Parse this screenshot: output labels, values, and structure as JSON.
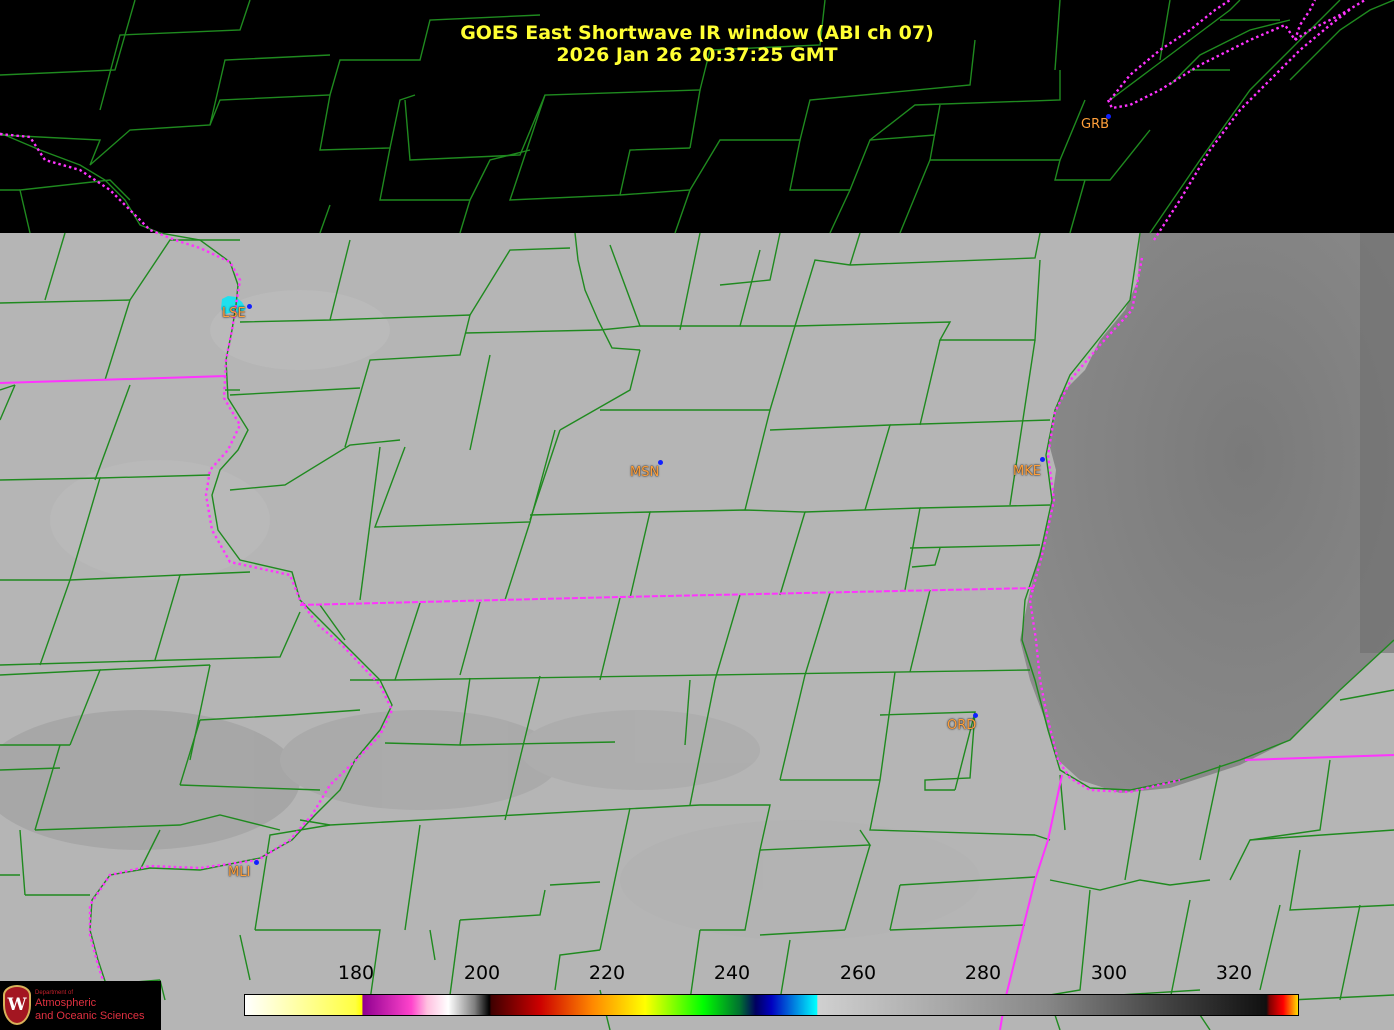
{
  "title": {
    "line1": "GOES East Shortwave IR window (ABI ch 07)",
    "line2": "2026 Jan 26  20:37:25 GMT"
  },
  "stations": [
    {
      "code": "GRB"
    },
    {
      "code": "LSE"
    },
    {
      "code": "MSN"
    },
    {
      "code": "MKE"
    },
    {
      "code": "ORD"
    },
    {
      "code": "MLI"
    }
  ],
  "colorbar": {
    "min": 163,
    "max": 330,
    "ticks": [
      "180",
      "200",
      "220",
      "240",
      "260",
      "280",
      "300",
      "320"
    ]
  },
  "logo": {
    "crest": "W",
    "department": "Department of",
    "name_line1": "Atmospheric",
    "name_line2": "and Oceanic Sciences"
  },
  "colors": {
    "title": "#ffff33",
    "station_label": "#ff9f3a",
    "station_dot": "#1020ff",
    "county_lines": "#1f8a1f",
    "state_borders": "#ff33ff",
    "land_cloud": "#b4b4b4",
    "lake_michigan": "#808080",
    "no_data": "#000000"
  }
}
